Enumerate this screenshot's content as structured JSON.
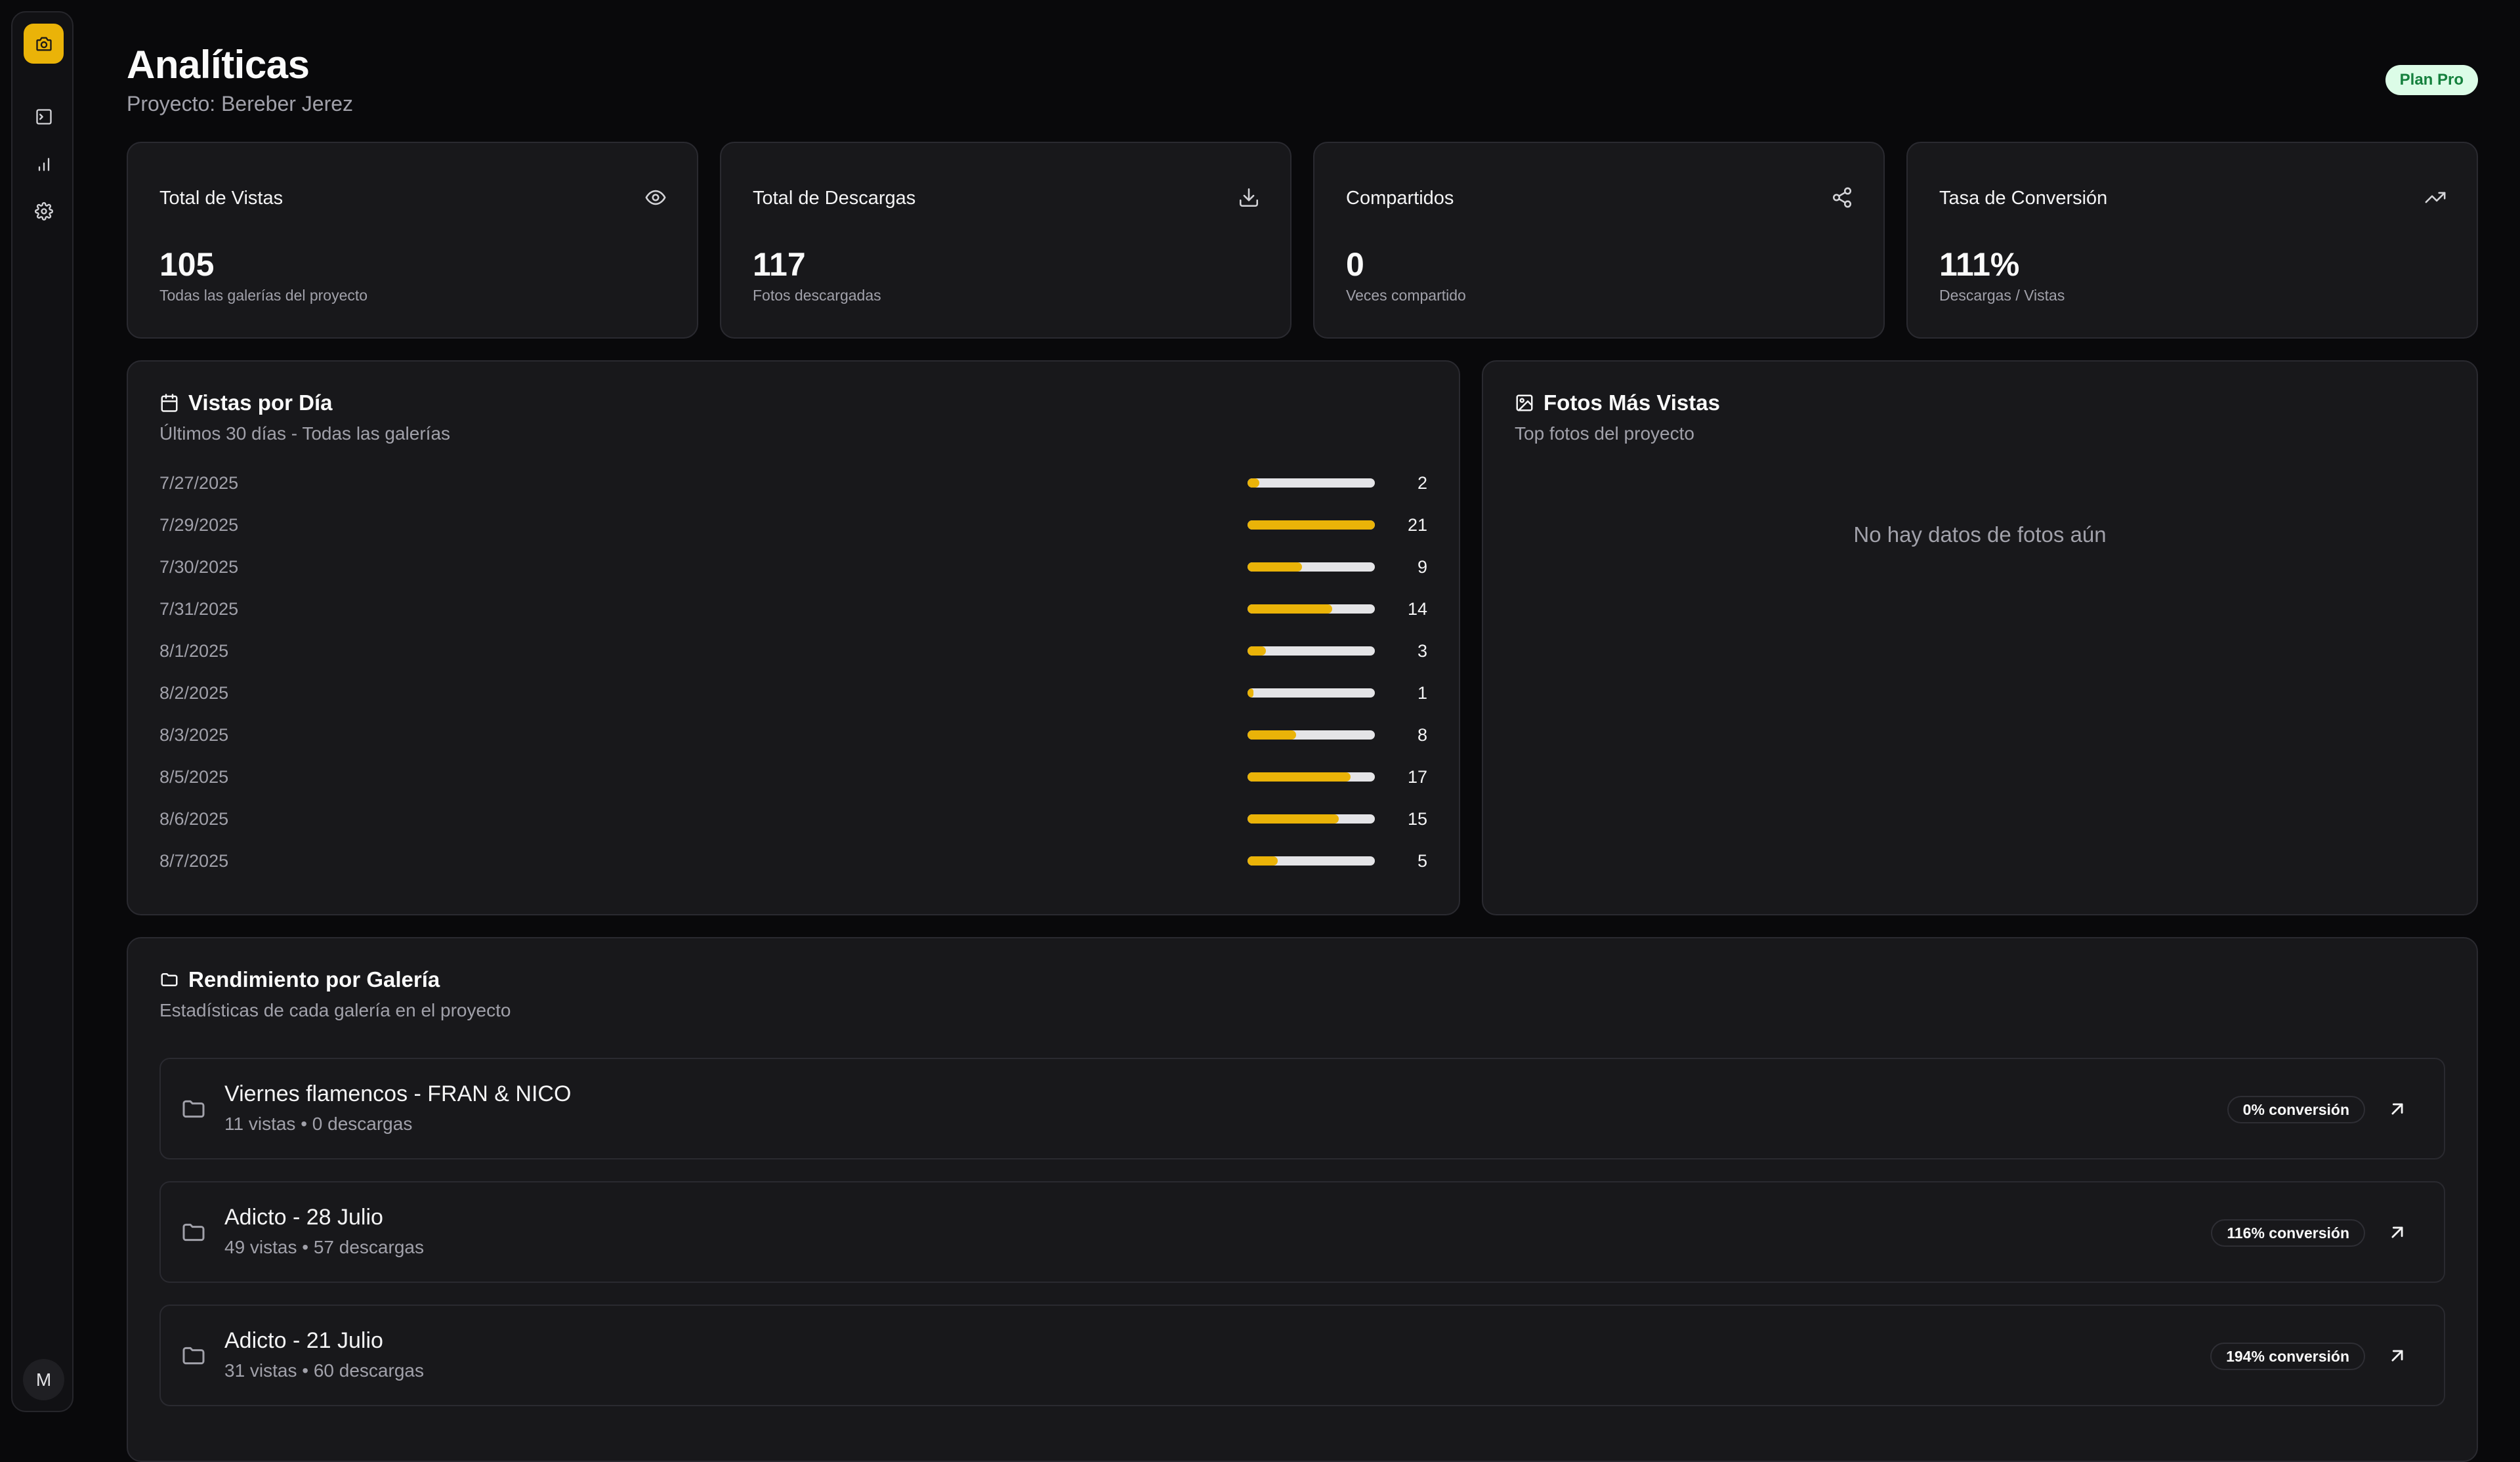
{
  "header": {
    "title": "Analíticas",
    "subtitle": "Proyecto: Bereber Jerez",
    "plan_badge": "Plan Pro"
  },
  "sidebar": {
    "avatar_initial": "M",
    "items": [
      {
        "icon": "camera-icon"
      },
      {
        "icon": "gallery-icon"
      },
      {
        "icon": "bar-chart-icon"
      },
      {
        "icon": "gear-icon"
      }
    ]
  },
  "stats": [
    {
      "title": "Total de Vistas",
      "value": "105",
      "desc": "Todas las galerías del proyecto",
      "icon": "eye-icon"
    },
    {
      "title": "Total de Descargas",
      "value": "117",
      "desc": "Fotos descargadas",
      "icon": "download-icon"
    },
    {
      "title": "Compartidos",
      "value": "0",
      "desc": "Veces compartido",
      "icon": "share-icon"
    },
    {
      "title": "Tasa de Conversión",
      "value": "111%",
      "desc": "Descargas / Vistas",
      "icon": "trending-up-icon"
    }
  ],
  "views_per_day": {
    "title": "Vistas por Día",
    "subtitle": "Últimos 30 días - Todas las galerías"
  },
  "chart_data": {
    "type": "bar",
    "categories": [
      "7/27/2025",
      "7/29/2025",
      "7/30/2025",
      "7/31/2025",
      "8/1/2025",
      "8/2/2025",
      "8/3/2025",
      "8/5/2025",
      "8/6/2025",
      "8/7/2025"
    ],
    "values": [
      2,
      21,
      9,
      14,
      3,
      1,
      8,
      17,
      15,
      5
    ],
    "ylim": [
      0,
      21
    ]
  },
  "top_photos": {
    "title": "Fotos Más Vistas",
    "subtitle": "Top fotos del proyecto",
    "empty": "No hay datos de fotos aún"
  },
  "gallery_performance": {
    "title": "Rendimiento por Galería",
    "subtitle": "Estadísticas de cada galería en el proyecto",
    "rows": [
      {
        "name": "Viernes flamencos - FRAN & NICO",
        "meta": "11 vistas • 0 descargas",
        "badge": "0% conversión"
      },
      {
        "name": "Adicto - 28 Julio",
        "meta": "49 vistas • 57 descargas",
        "badge": "116% conversión"
      },
      {
        "name": "Adicto - 21 Julio",
        "meta": "31 vistas • 60 descargas",
        "badge": "194% conversión"
      }
    ]
  },
  "colors": {
    "accent": "#eab308",
    "background": "#09090b",
    "card": "#18181b",
    "badge_bg": "#dcfce7",
    "badge_text": "#15803d"
  }
}
